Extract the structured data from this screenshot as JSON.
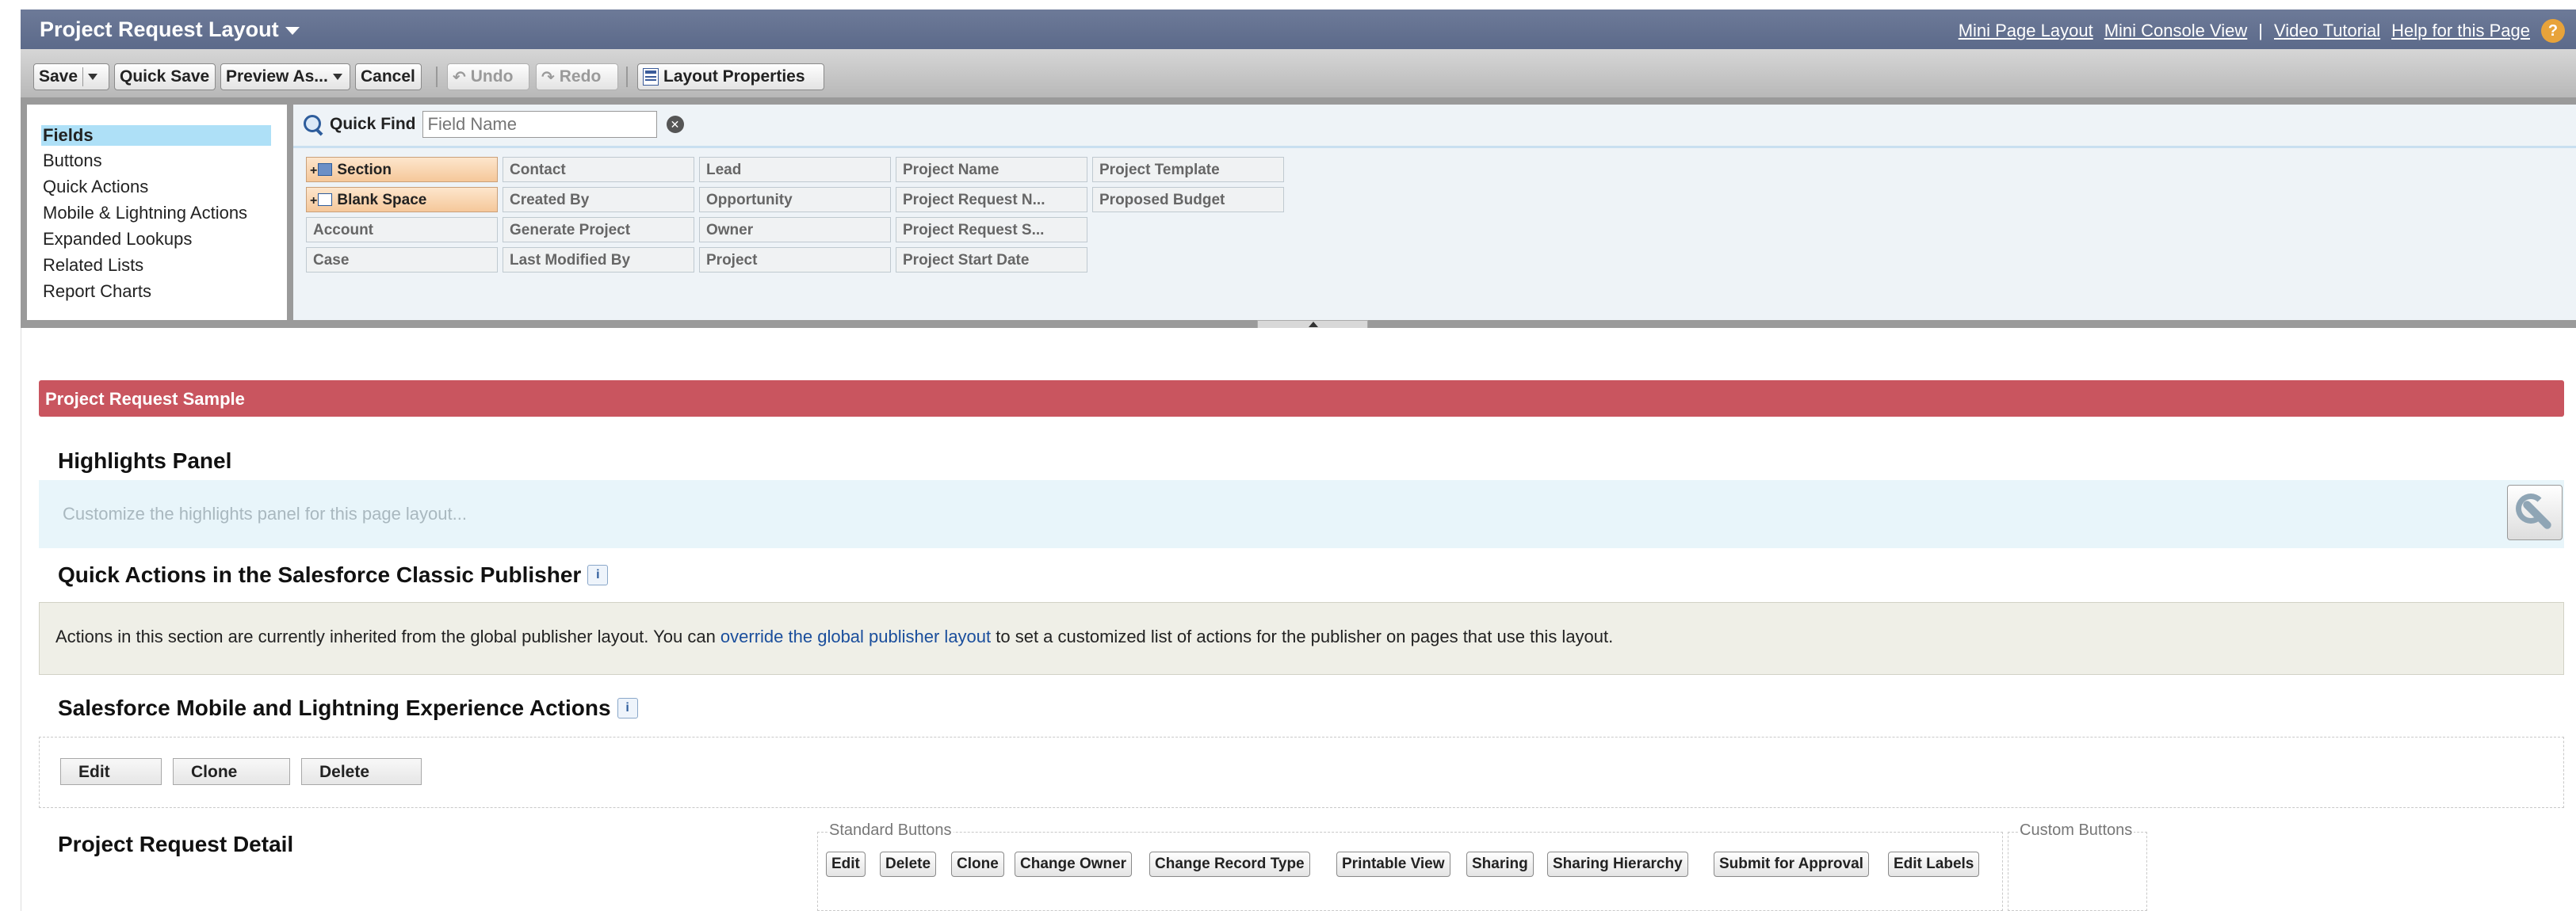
{
  "header": {
    "title": "Project Request Layout",
    "links": {
      "mini_page_layout": "Mini Page Layout",
      "mini_console_view": "Mini Console View",
      "separator": "|",
      "video_tutorial": "Video Tutorial",
      "help": "Help for this Page"
    },
    "help_icon": "?"
  },
  "toolbar": {
    "save": "Save",
    "quick_save": "Quick Save",
    "preview_as": "Preview As...",
    "cancel": "Cancel",
    "undo": "Undo",
    "redo": "Redo",
    "layout_properties": "Layout Properties"
  },
  "palette": {
    "categories": [
      "Fields",
      "Buttons",
      "Quick Actions",
      "Mobile & Lightning Actions",
      "Expanded Lookups",
      "Related Lists",
      "Report Charts"
    ],
    "active_category": "Fields",
    "quick_find_label": "Quick Find",
    "quick_find_placeholder": "Field Name",
    "fields": {
      "section": "Section",
      "blank_space": "Blank Space",
      "account": "Account",
      "case": "Case",
      "contact": "Contact",
      "created_by": "Created By",
      "generate_project": "Generate Project",
      "last_modified_by": "Last Modified By",
      "lead": "Lead",
      "opportunity": "Opportunity",
      "owner": "Owner",
      "project": "Project",
      "project_name": "Project Name",
      "project_request_n": "Project Request N...",
      "project_request_s": "Project Request S...",
      "project_start_date": "Project Start Date",
      "project_template": "Project Template",
      "proposed_budget": "Proposed Budget"
    }
  },
  "layout": {
    "sample_title": "Project Request Sample",
    "highlights_title": "Highlights Panel",
    "highlights_placeholder": "Customize the highlights panel for this page layout...",
    "classic_publisher_title": "Quick Actions in the Salesforce Classic Publisher",
    "inherit_text_before": "Actions in this section are currently inherited from the global publisher layout. You can ",
    "inherit_link": "override the global publisher layout",
    "inherit_text_after": " to set a customized list of actions for the publisher on pages that use this layout.",
    "mobile_actions_title": "Salesforce Mobile and Lightning Experience Actions",
    "mobile_actions": [
      "Edit",
      "Clone",
      "Delete"
    ],
    "detail_title": "Project Request Detail",
    "standard_buttons_label": "Standard Buttons",
    "standard_buttons": [
      "Edit",
      "Delete",
      "Clone",
      "Change Owner",
      "Change Record Type",
      "Printable View",
      "Sharing",
      "Sharing Hierarchy",
      "Submit for Approval",
      "Edit Labels"
    ],
    "custom_buttons_label": "Custom Buttons"
  },
  "colors": {
    "header": "#5c6a8a",
    "section_bar": "#c9555f",
    "active_category": "#aee0f7",
    "link": "#1a4e9c",
    "highlights_bg": "#e8f5fa"
  }
}
